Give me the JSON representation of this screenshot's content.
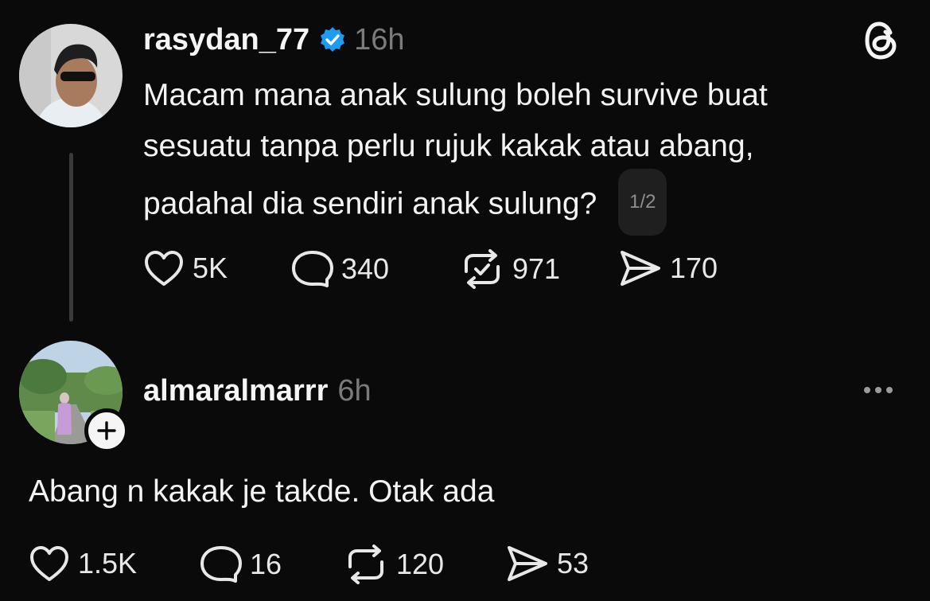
{
  "post": {
    "username": "rasydan_77",
    "time": "16h",
    "text_lines": [
      "Macam mana anak sulung boleh survive buat",
      "sesuatu tanpa perlu rujuk kakak atau abang,",
      "padahal dia sendiri anak sulung?"
    ],
    "page_indicator": "1/2",
    "likes": "5K",
    "replies": "340",
    "reposts": "971",
    "shares": "170"
  },
  "reply": {
    "username": "almaralmarrr",
    "time": "6h",
    "text": "Abang n kakak je takde. Otak ada",
    "likes": "1.5K",
    "replies": "16",
    "reposts": "120",
    "shares": "53"
  },
  "colors": {
    "background": "#0a0a0a",
    "verified": "#1d9bf0",
    "muted": "#7b7b7b"
  },
  "icons": [
    "threads-logo-icon",
    "verified-badge-icon",
    "heart-icon",
    "comment-icon",
    "repost-icon",
    "share-icon",
    "more-icon",
    "plus-icon"
  ]
}
